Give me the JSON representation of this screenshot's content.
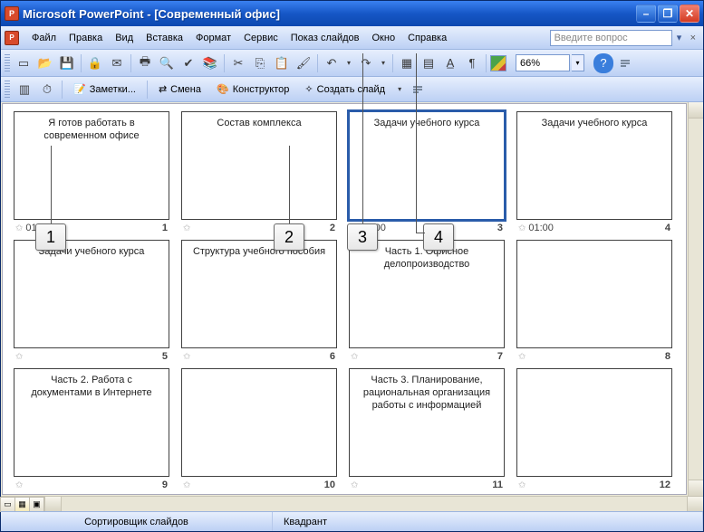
{
  "titlebar": {
    "app": "Microsoft PowerPoint",
    "doc": "[Современный офис]"
  },
  "menu": {
    "file": "Файл",
    "edit": "Правка",
    "view": "Вид",
    "insert": "Вставка",
    "format": "Формат",
    "tools": "Сервис",
    "slideshow": "Показ слайдов",
    "window": "Окно",
    "help": "Справка"
  },
  "help_search_placeholder": "Введите вопрос",
  "toolbar": {
    "zoom": "66%"
  },
  "toolbar2": {
    "notes": "Заметки...",
    "transition": "Смена",
    "design": "Конструктор",
    "new_slide": "Создать слайд"
  },
  "callouts": {
    "c1": "1",
    "c2": "2",
    "c3": "3",
    "c4": "4"
  },
  "slides": [
    {
      "title": "Я готов работать в современном офисе",
      "time": "01:20",
      "num": "1",
      "selected": false,
      "has_time": true
    },
    {
      "title": "Состав комплекса",
      "time": "",
      "num": "2",
      "selected": false,
      "has_time": false
    },
    {
      "title": "Задачи учебного курса",
      "time": "01:00",
      "num": "3",
      "selected": true,
      "has_time": true
    },
    {
      "title": "Задачи учебного курса",
      "time": "01:00",
      "num": "4",
      "selected": false,
      "has_time": true
    },
    {
      "title": "Задачи учебного курса",
      "time": "",
      "num": "5",
      "selected": false,
      "has_time": false
    },
    {
      "title": "Структура учебного пособия",
      "time": "",
      "num": "6",
      "selected": false,
      "has_time": false
    },
    {
      "title": "Часть 1. Офисное делопроизводство",
      "time": "",
      "num": "7",
      "selected": false,
      "has_time": false
    },
    {
      "title": "",
      "time": "",
      "num": "8",
      "selected": false,
      "has_time": false
    },
    {
      "title": "Часть 2. Работа с документами в Интернете",
      "time": "",
      "num": "9",
      "selected": false,
      "has_time": false
    },
    {
      "title": "",
      "time": "",
      "num": "10",
      "selected": false,
      "has_time": false
    },
    {
      "title": "Часть 3. Планирование, рациональная организация работы с информацией",
      "time": "",
      "num": "11",
      "selected": false,
      "has_time": false
    },
    {
      "title": "",
      "time": "",
      "num": "12",
      "selected": false,
      "has_time": false
    }
  ],
  "status": {
    "left": "Сортировщик слайдов",
    "center": "Квадрант"
  }
}
